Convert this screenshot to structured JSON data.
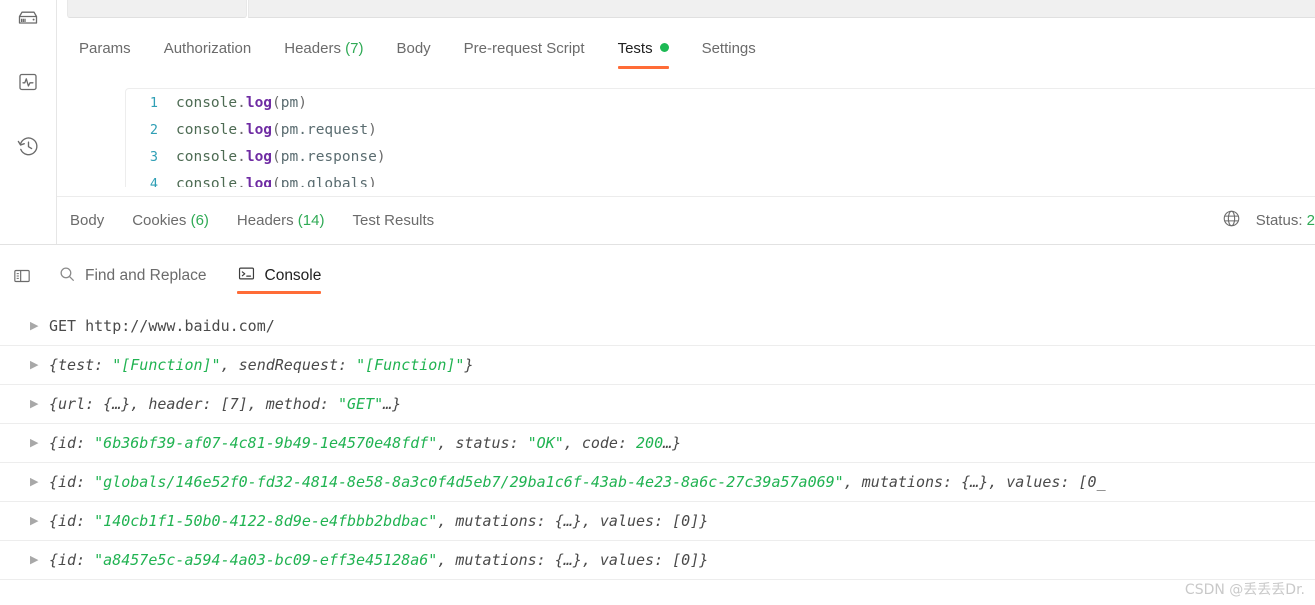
{
  "sidebar": {
    "items": [
      {
        "name": "mock-server-icon",
        "label": "Mock Servers"
      },
      {
        "name": "monitor-icon",
        "label": "Monitors"
      },
      {
        "name": "history-icon",
        "label": "History"
      }
    ]
  },
  "request": {
    "tabs": [
      {
        "label": "Params",
        "count": "",
        "active": false,
        "dot": false
      },
      {
        "label": "Authorization",
        "count": "",
        "active": false,
        "dot": false
      },
      {
        "label": "Headers",
        "count": "(7)",
        "active": false,
        "dot": false
      },
      {
        "label": "Body",
        "count": "",
        "active": false,
        "dot": false
      },
      {
        "label": "Pre-request Script",
        "count": "",
        "active": false,
        "dot": false
      },
      {
        "label": "Tests",
        "count": "",
        "active": true,
        "dot": true
      },
      {
        "label": "Settings",
        "count": "",
        "active": false,
        "dot": false
      }
    ],
    "code": [
      {
        "num": "1",
        "parts": [
          {
            "t": "console",
            "c": "t-plain"
          },
          {
            "t": ".",
            "c": "t-punc"
          },
          {
            "t": "log",
            "c": "t-fn"
          },
          {
            "t": "(",
            "c": "t-punc"
          },
          {
            "t": "pm",
            "c": "t-var"
          },
          {
            "t": ")",
            "c": "t-punc"
          }
        ]
      },
      {
        "num": "2",
        "parts": [
          {
            "t": "console",
            "c": "t-plain"
          },
          {
            "t": ".",
            "c": "t-punc"
          },
          {
            "t": "log",
            "c": "t-fn"
          },
          {
            "t": "(",
            "c": "t-punc"
          },
          {
            "t": "pm.request",
            "c": "t-var"
          },
          {
            "t": ")",
            "c": "t-punc"
          }
        ]
      },
      {
        "num": "3",
        "parts": [
          {
            "t": "console",
            "c": "t-plain"
          },
          {
            "t": ".",
            "c": "t-punc"
          },
          {
            "t": "log",
            "c": "t-fn"
          },
          {
            "t": "(",
            "c": "t-punc"
          },
          {
            "t": "pm.response",
            "c": "t-var"
          },
          {
            "t": ")",
            "c": "t-punc"
          }
        ]
      },
      {
        "num": "4",
        "parts": [
          {
            "t": "console",
            "c": "t-plain"
          },
          {
            "t": ".",
            "c": "t-punc"
          },
          {
            "t": "log",
            "c": "t-fn"
          },
          {
            "t": "(",
            "c": "t-punc"
          },
          {
            "t": "pm.globals",
            "c": "t-var"
          },
          {
            "t": ")",
            "c": "t-punc"
          }
        ]
      }
    ]
  },
  "response": {
    "tabs": [
      {
        "label": "Body",
        "count": ""
      },
      {
        "label": "Cookies",
        "count": "(6)"
      },
      {
        "label": "Headers",
        "count": "(14)"
      },
      {
        "label": "Test Results",
        "count": ""
      }
    ],
    "status_label": "Status: ",
    "status_code": "2",
    "globe_icon": "globe-icon"
  },
  "console_toolbar": {
    "panel_toggle_icon": "sidebar-panel-icon",
    "find_replace": {
      "icon": "search-icon",
      "label": "Find and Replace"
    },
    "console": {
      "icon": "terminal-icon",
      "label": "Console",
      "active": true
    }
  },
  "console_logs": [
    {
      "italic": false,
      "parts": [
        {
          "t": "GET http://www.baidu.com/",
          "c": "s-grey"
        }
      ]
    },
    {
      "italic": true,
      "parts": [
        {
          "t": "{test: ",
          "c": "s-grey"
        },
        {
          "t": "\"[Function]\"",
          "c": "s-green"
        },
        {
          "t": ", sendRequest: ",
          "c": "s-grey"
        },
        {
          "t": "\"[Function]\"",
          "c": "s-green"
        },
        {
          "t": "}",
          "c": "s-grey"
        }
      ]
    },
    {
      "italic": true,
      "parts": [
        {
          "t": "{url: {…}, header: [7], method: ",
          "c": "s-grey"
        },
        {
          "t": "\"GET\"",
          "c": "s-green"
        },
        {
          "t": "…}",
          "c": "s-grey"
        }
      ]
    },
    {
      "italic": true,
      "parts": [
        {
          "t": "{id: ",
          "c": "s-grey"
        },
        {
          "t": "\"6b36bf39-af07-4c81-9b49-1e4570e48fdf\"",
          "c": "s-green"
        },
        {
          "t": ", status: ",
          "c": "s-grey"
        },
        {
          "t": "\"OK\"",
          "c": "s-green"
        },
        {
          "t": ", code: ",
          "c": "s-grey"
        },
        {
          "t": "200",
          "c": "s-green"
        },
        {
          "t": "…}",
          "c": "s-grey"
        }
      ]
    },
    {
      "italic": true,
      "parts": [
        {
          "t": "{id: ",
          "c": "s-grey"
        },
        {
          "t": "\"globals/146e52f0-fd32-4814-8e58-8a3c0f4d5eb7/29ba1c6f-43ab-4e23-8a6c-27c39a57a069\"",
          "c": "s-green"
        },
        {
          "t": ", mutations: {…}, values: [0_",
          "c": "s-grey"
        }
      ]
    },
    {
      "italic": true,
      "parts": [
        {
          "t": "{id: ",
          "c": "s-grey"
        },
        {
          "t": "\"140cb1f1-50b0-4122-8d9e-e4fbbb2bdbac\"",
          "c": "s-green"
        },
        {
          "t": ", mutations: {…}, values: [0]}",
          "c": "s-grey"
        }
      ]
    },
    {
      "italic": true,
      "parts": [
        {
          "t": "{id: ",
          "c": "s-grey"
        },
        {
          "t": "\"a8457e5c-a594-4a03-bc09-eff3e45128a6\"",
          "c": "s-green"
        },
        {
          "t": ", mutations: {…}, values: [0]}",
          "c": "s-grey"
        }
      ]
    }
  ],
  "watermark": {
    "text": "CSDN @丢丢丢Dr."
  },
  "colors": {
    "accent": "#ff6c37",
    "green": "#1db954",
    "count_green": "#2faa55",
    "text": "#212121",
    "muted": "#6b6b6b"
  }
}
